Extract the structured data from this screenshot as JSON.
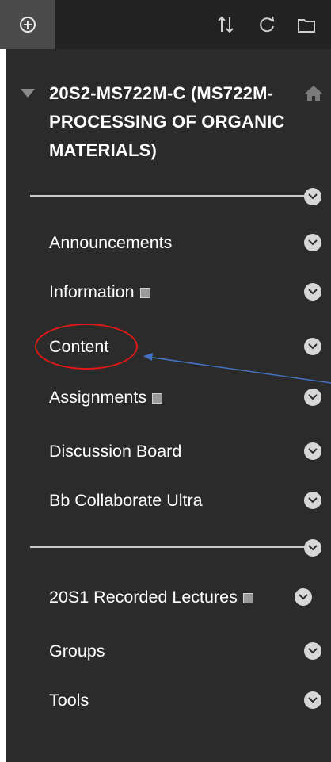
{
  "toolbar": {
    "icons": [
      "add-icon",
      "sort-icon",
      "refresh-icon",
      "folder-icon"
    ]
  },
  "course": {
    "title": "20S2-MS722M-C (MS722M-PROCESSING OF ORGANIC MATERIALS)",
    "home_icon": "home-icon"
  },
  "menu": {
    "items": [
      {
        "label": "Announcements",
        "page_icon": false
      },
      {
        "label": "Information",
        "page_icon": true
      },
      {
        "label": "Content",
        "page_icon": false
      },
      {
        "label": "Assignments",
        "page_icon": true
      },
      {
        "label": "Discussion Board",
        "page_icon": false
      },
      {
        "label": "Bb Collaborate Ultra",
        "page_icon": false
      },
      {
        "label": "20S1 Recorded Lectures",
        "page_icon": true
      },
      {
        "label": "Groups",
        "page_icon": false
      },
      {
        "label": "Tools",
        "page_icon": false
      }
    ]
  },
  "annotation": {
    "ellipse_color": "#e01818",
    "arrow_color": "#4472c4"
  },
  "colors": {
    "panel_bg": "#2b2b2b",
    "toolbar_bg": "#222222",
    "text": "#ffffff"
  }
}
